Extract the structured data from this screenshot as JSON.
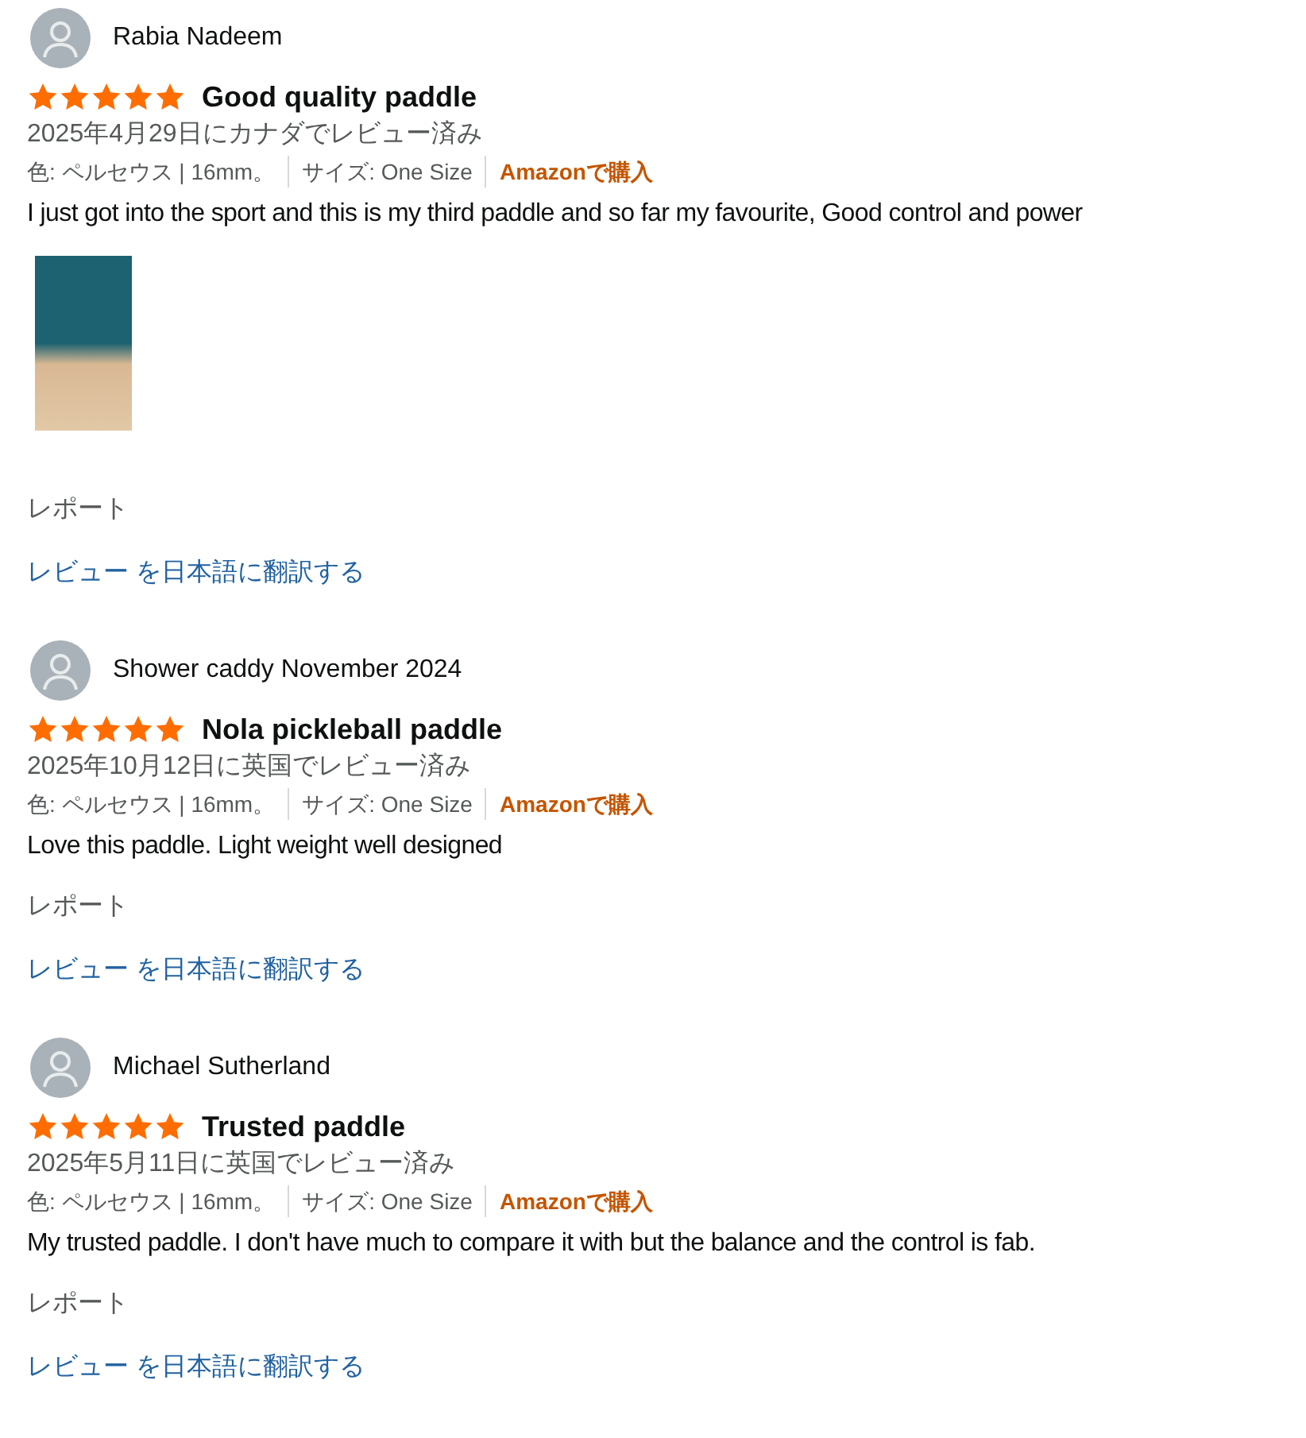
{
  "reviews": [
    {
      "reviewer": "Rabia Nadeem",
      "stars": 5,
      "title": "Good quality paddle",
      "date": "2025年4月29日にカナダでレビュー済み",
      "variant": "色: ペルセウス | 16mm。",
      "size": "サイズ: One Size",
      "purchase": "Amazonで購入",
      "body": "I just got into the sport and this is my third paddle and so far my favourite, Good control and power",
      "has_photo": true,
      "report": "レポート",
      "translate": "レビュー を日本語に翻訳する"
    },
    {
      "reviewer": "Shower caddy November 2024",
      "stars": 5,
      "title": "Nola pickleball paddle",
      "date": "2025年10月12日に英国でレビュー済み",
      "variant": "色: ペルセウス | 16mm。",
      "size": "サイズ: One Size",
      "purchase": "Amazonで購入",
      "body": "Love this paddle. Light weight well designed",
      "has_photo": false,
      "report": "レポート",
      "translate": "レビュー を日本語に翻訳する"
    },
    {
      "reviewer": "Michael Sutherland",
      "stars": 5,
      "title": "Trusted paddle",
      "date": "2025年5月11日に英国でレビュー済み",
      "variant": "色: ペルセウス | 16mm。",
      "size": "サイズ: One Size",
      "purchase": "Amazonで購入",
      "body": "My trusted paddle. I don't have much to compare it with but the balance and the control is fab.",
      "has_photo": false,
      "report": "レポート",
      "translate": "レビュー を日本語に翻訳する"
    }
  ]
}
